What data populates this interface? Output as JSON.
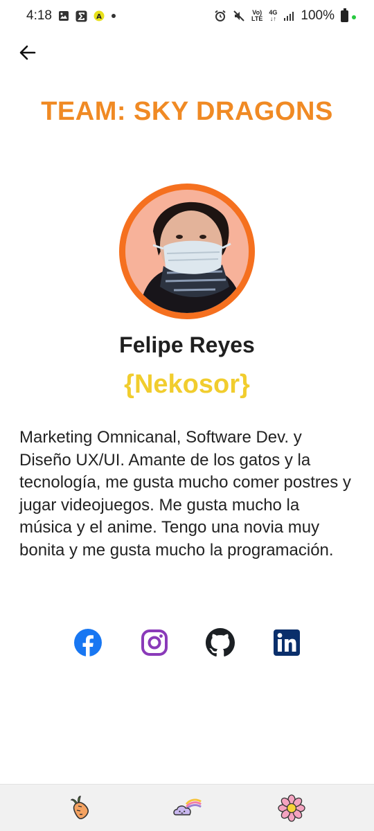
{
  "status_bar": {
    "time": "4:18",
    "battery_percent": "100%",
    "icons": [
      "image-icon",
      "sigma-icon",
      "accessibility-icon",
      "dot-icon",
      "alarm-icon",
      "mute-icon",
      "volte-icon",
      "4g-icon",
      "signal-icon",
      "battery-icon"
    ]
  },
  "header": {
    "back_icon": "arrow-left-icon",
    "team_title": "TEAM: SKY DRAGONS"
  },
  "profile": {
    "name": "Felipe Reyes",
    "nickname": "{Nekosor}",
    "bio": "Marketing Omnicanal, Software Dev. y Diseño UX/UI. Amante de los gatos y la tecnología, me gusta mucho comer postres y jugar videojuegos. Me gusta mucho la música y el anime. Tengo una novia muy bonita y me gusta mucho la programación."
  },
  "socials": [
    {
      "name": "facebook",
      "icon": "facebook-icon",
      "color": "#1877f2"
    },
    {
      "name": "instagram",
      "icon": "instagram-icon",
      "color": "#8a3ab9"
    },
    {
      "name": "github",
      "icon": "github-icon",
      "color": "#1b1f23"
    },
    {
      "name": "linkedin",
      "icon": "linkedin-icon",
      "color": "#0a2f6b"
    }
  ],
  "bottom_nav": [
    {
      "icon": "carrot-icon"
    },
    {
      "icon": "rainbow-cloud-icon"
    },
    {
      "icon": "flower-icon"
    }
  ],
  "colors": {
    "title_orange": "#f08a24",
    "avatar_ring": "#f5701f",
    "nickname_yellow": "#f1cd2e",
    "nav_background": "#f1f1f1"
  }
}
